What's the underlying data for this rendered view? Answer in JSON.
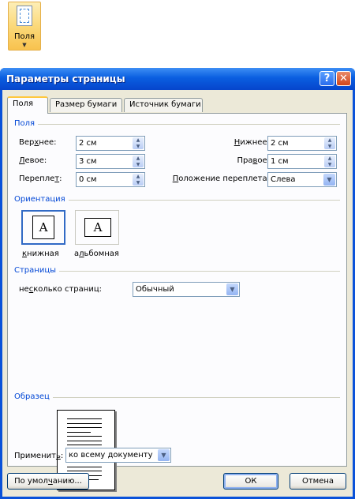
{
  "ribbon": {
    "button_label": "Поля",
    "icon": "page-margins-icon"
  },
  "dialog": {
    "title": "Параметры страницы",
    "help_glyph": "?",
    "close_glyph": "✕",
    "tabs": [
      {
        "label": "Поля",
        "active": true
      },
      {
        "label": "Размер бумаги",
        "active": false
      },
      {
        "label": "Источник бумаги",
        "active": false
      }
    ],
    "margins_section": "Поля",
    "top": {
      "label_before": "Вер",
      "label_ul": "х",
      "label_after": "нее:",
      "value": "2 см"
    },
    "left": {
      "label_before": "",
      "label_ul": "Л",
      "label_after": "евое:",
      "value": "3 см"
    },
    "gutter": {
      "label_before": "Перепле",
      "label_ul": "т",
      "label_after": ":",
      "value": "0 см"
    },
    "bottom": {
      "label_before": "",
      "label_ul": "Н",
      "label_after": "ижнее:",
      "value": "2 см"
    },
    "right": {
      "label_before": "Пра",
      "label_ul": "в",
      "label_after": "ое:",
      "value": "1 см"
    },
    "gutter_position": {
      "label_before": "",
      "label_ul": "П",
      "label_after": "оложение переплета:",
      "value": "Слева"
    },
    "orientation_section": "Ориентация",
    "portrait": {
      "label_before": "",
      "label_ul": "к",
      "label_after": "нижная",
      "glyph": "A"
    },
    "landscape": {
      "label_before": "а",
      "label_ul": "л",
      "label_after": "ьбомная",
      "glyph": "A"
    },
    "pages_section": "Страницы",
    "multiple_pages": {
      "label_before": "не",
      "label_ul": "с",
      "label_after": "колько страниц:",
      "value": "Обычный"
    },
    "sample_section": "Образец",
    "apply_to": {
      "label_before": "Применит",
      "label_ul": "ь",
      "label_after": ":",
      "value": "ко всему документу"
    },
    "default_button": {
      "label_before": "По умол",
      "label_ul": "ч",
      "label_after": "анию..."
    },
    "ok_button": "ОК",
    "cancel_button": "Отмена"
  },
  "colors": {
    "title_bar": "#0a5ee0",
    "section_text": "#0046d5",
    "panel_bg": "#fcfcfe"
  }
}
